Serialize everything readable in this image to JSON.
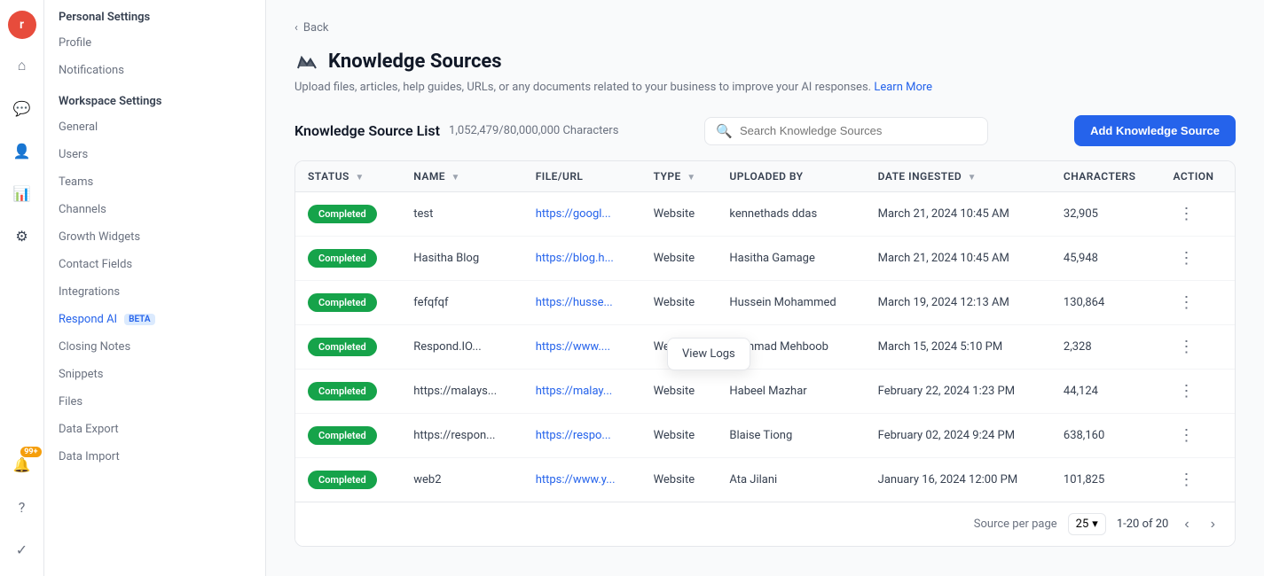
{
  "sidebar": {
    "avatar_letter": "r",
    "personal_settings_label": "Personal Settings",
    "personal_items": [
      {
        "label": "Profile"
      },
      {
        "label": "Notifications"
      }
    ],
    "workspace_settings_label": "Workspace Settings",
    "workspace_items": [
      {
        "label": "General",
        "active": false
      },
      {
        "label": "Users",
        "active": false
      },
      {
        "label": "Teams",
        "active": false
      },
      {
        "label": "Channels",
        "active": false
      },
      {
        "label": "Growth Widgets",
        "active": false
      },
      {
        "label": "Contact Fields",
        "active": false
      },
      {
        "label": "Integrations",
        "active": false
      },
      {
        "label": "Respond AI",
        "active": true,
        "beta": true
      },
      {
        "label": "Closing Notes",
        "active": false
      },
      {
        "label": "Snippets",
        "active": false
      },
      {
        "label": "Files",
        "active": false
      },
      {
        "label": "Data Export",
        "active": false
      },
      {
        "label": "Data Import",
        "active": false
      }
    ],
    "nav_icons": [
      {
        "name": "home-icon",
        "symbol": "⌂"
      },
      {
        "name": "chat-icon",
        "symbol": "💬"
      },
      {
        "name": "contacts-icon",
        "symbol": "👤"
      },
      {
        "name": "reports-icon",
        "symbol": "📊"
      },
      {
        "name": "settings-icon",
        "symbol": "⚙"
      },
      {
        "name": "bell-icon",
        "symbol": "🔔",
        "count": "99+"
      },
      {
        "name": "help-icon",
        "symbol": "?"
      },
      {
        "name": "checkmark-icon",
        "symbol": "✓"
      }
    ]
  },
  "page": {
    "back_label": "Back",
    "title": "Knowledge Sources",
    "subtitle": "Upload files, articles, help guides, URLs, or any documents related to your business to improve your AI responses.",
    "learn_more_label": "Learn More",
    "table_title": "Knowledge Source List",
    "char_count": "1,052,479/80,000,000 Characters",
    "search_placeholder": "Search Knowledge Sources",
    "add_button_label": "Add Knowledge Source",
    "view_logs_label": "View Logs"
  },
  "table": {
    "columns": [
      {
        "key": "status",
        "label": "STATUS"
      },
      {
        "key": "name",
        "label": "NAME"
      },
      {
        "key": "file_url",
        "label": "FILE/URL"
      },
      {
        "key": "type",
        "label": "TYPE"
      },
      {
        "key": "uploaded_by",
        "label": "UPLOADED BY"
      },
      {
        "key": "date_ingested",
        "label": "DATE INGESTED"
      },
      {
        "key": "characters",
        "label": "CHARACTERS"
      },
      {
        "key": "action",
        "label": "ACTION"
      }
    ],
    "rows": [
      {
        "status": "Completed",
        "name": "test",
        "file_url": "https://googl...",
        "type": "Website",
        "uploaded_by": "kennethads ddas",
        "date_ingested": "March 21, 2024 10:45 AM",
        "characters": "32,905"
      },
      {
        "status": "Completed",
        "name": "Hasitha Blog",
        "file_url": "https://blog.h...",
        "type": "Website",
        "uploaded_by": "Hasitha Gamage",
        "date_ingested": "March 21, 2024 10:45 AM",
        "characters": "45,948"
      },
      {
        "status": "Completed",
        "name": "fefqfqf",
        "file_url": "https://husse...",
        "type": "Website",
        "uploaded_by": "Hussein Mohammed",
        "date_ingested": "March 19, 2024 12:13 AM",
        "characters": "130,864"
      },
      {
        "status": "Completed",
        "name": "Respond.IO...",
        "file_url": "https://www....",
        "type": "Website",
        "uploaded_by": "Hammad Mehboob",
        "date_ingested": "March 15, 2024 5:10 PM",
        "characters": "2,328"
      },
      {
        "status": "Completed",
        "name": "https://malays...",
        "file_url": "https://malay...",
        "type": "Website",
        "uploaded_by": "Habeel Mazhar",
        "date_ingested": "February 22, 2024 1:23 PM",
        "characters": "44,124"
      },
      {
        "status": "Completed",
        "name": "https://respon...",
        "file_url": "https://respo...",
        "type": "Website",
        "uploaded_by": "Blaise Tiong",
        "date_ingested": "February 02, 2024 9:24 PM",
        "characters": "638,160"
      },
      {
        "status": "Completed",
        "name": "web2",
        "file_url": "https://www.y...",
        "type": "Website",
        "uploaded_by": "Ata Jilani",
        "date_ingested": "January 16, 2024 12:00 PM",
        "characters": "101,825"
      }
    ]
  },
  "pagination": {
    "source_per_page_label": "Source per page",
    "per_page_value": "25",
    "range_label": "1-20 of 20"
  }
}
